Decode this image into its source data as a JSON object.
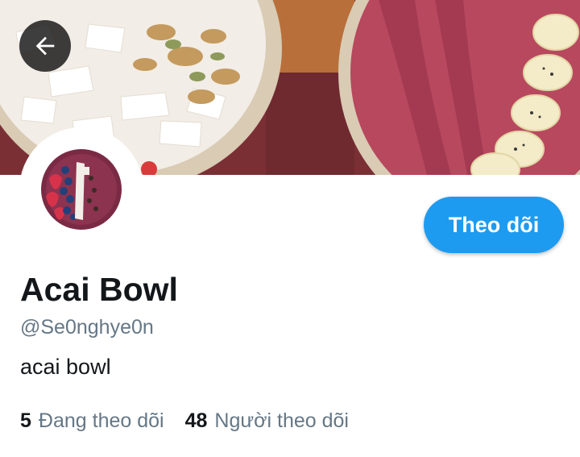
{
  "profile": {
    "display_name": "Acai Bowl",
    "handle": "@Se0nghye0n",
    "bio": "acai bowl",
    "follow_label": "Theo dõi"
  },
  "stats": {
    "following_count": "5",
    "following_label": "Đang theo dõi",
    "followers_count": "48",
    "followers_label": "Người theo dõi"
  },
  "icons": {
    "back": "arrow-left-icon"
  },
  "colors": {
    "accent": "#1d9bf0",
    "secondary_text": "#657786",
    "primary_text": "#14171a"
  }
}
